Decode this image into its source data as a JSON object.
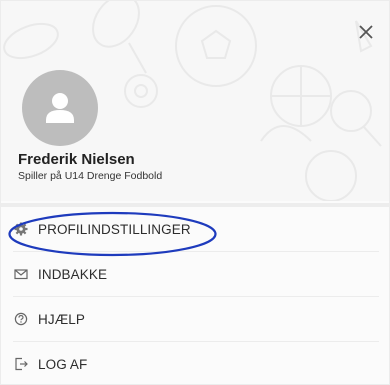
{
  "profile": {
    "name": "Frederik Nielsen",
    "role": "Spiller på U14 Drenge Fodbold"
  },
  "menu": {
    "items": [
      {
        "label": "PROFILINDSTILLINGER",
        "icon": "gear-icon"
      },
      {
        "label": "INDBAKKE",
        "icon": "envelope-icon"
      },
      {
        "label": "HJÆLP",
        "icon": "help-icon"
      },
      {
        "label": "LOG AF",
        "icon": "logout-icon"
      }
    ]
  },
  "colors": {
    "highlight": "#1e3bbd",
    "avatar": "#bdbdbd",
    "text": "#2d2d2d"
  }
}
